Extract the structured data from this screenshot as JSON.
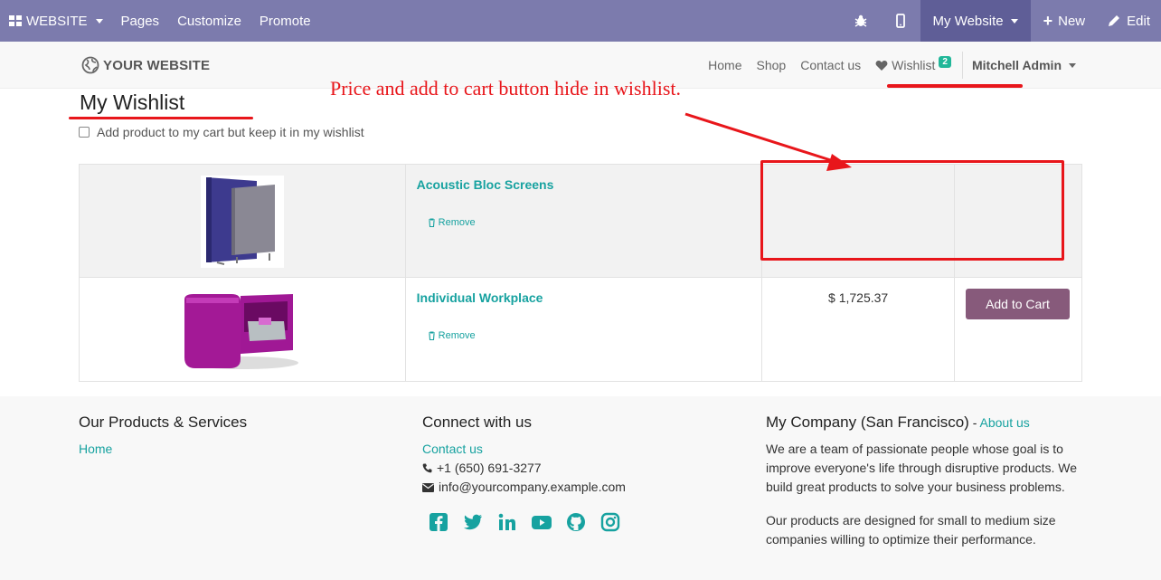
{
  "adminbar": {
    "website_label": "WEBSITE",
    "pages": "Pages",
    "customize": "Customize",
    "promote": "Promote",
    "my_website": "My Website",
    "new": "New",
    "edit": "Edit"
  },
  "header": {
    "logo_text": "YOUR WEBSITE",
    "nav": [
      "Home",
      "Shop",
      "Contact us"
    ],
    "wishlist_label": "Wishlist",
    "wishlist_count": "2",
    "user": "Mitchell Admin"
  },
  "page": {
    "title": "My Wishlist",
    "checkbox_label": "Add product to my cart but keep it in my wishlist"
  },
  "wishlist": [
    {
      "name": "Acoustic Bloc Screens",
      "remove": "Remove",
      "price": "",
      "cart_label": ""
    },
    {
      "name": "Individual Workplace",
      "remove": "Remove",
      "price": "$ 1,725.37",
      "cart_label": "Add to Cart"
    }
  ],
  "annotation": {
    "text": "Price and add to cart button hide in wishlist."
  },
  "footer": {
    "col1": {
      "title": "Our Products & Services",
      "link": "Home"
    },
    "col2": {
      "title": "Connect with us",
      "link": "Contact us",
      "phone": "+1 (650) 691-3277",
      "email": "info@yourcompany.example.com"
    },
    "col3": {
      "title": "My Company (San Francisco)",
      "separator": " - ",
      "about": "About us",
      "p1": "We are a team of passionate people whose goal is to improve everyone's life through disruptive products. We build great products to solve your business problems.",
      "p2": "Our products are designed for small to medium size companies willing to optimize their performance."
    },
    "social_icons": [
      "facebook-icon",
      "twitter-icon",
      "linkedin-icon",
      "youtube-icon",
      "github-icon",
      "instagram-icon"
    ]
  },
  "colors": {
    "admin_bar": "#7c7bad",
    "accent": "#17a2a0",
    "cart_button": "#875a7b",
    "annotation": "#e8161b"
  }
}
